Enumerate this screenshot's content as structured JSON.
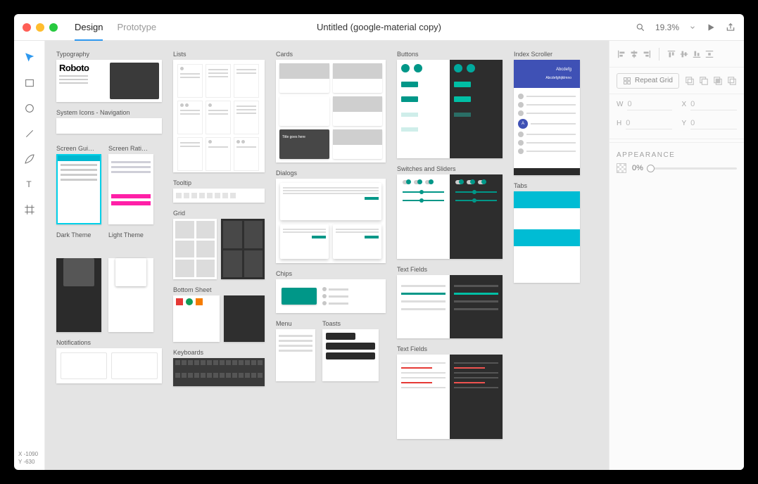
{
  "window": {
    "title": "Untitled (google-material copy)"
  },
  "tabs": {
    "design": "Design",
    "prototype": "Prototype"
  },
  "header": {
    "zoom": "19.3%",
    "icons": {
      "search": "search-icon",
      "chevron": "chevron-down-icon",
      "play": "play-icon",
      "share": "share-icon"
    }
  },
  "toolbar": {
    "items": [
      "select",
      "rectangle",
      "ellipse",
      "line",
      "pen",
      "text",
      "artboard"
    ]
  },
  "footer": {
    "x_label": "X",
    "x_value": "-1090",
    "y_label": "Y",
    "y_value": "-630"
  },
  "canvas": {
    "col1": {
      "typography": "Typography",
      "roboto": "Roboto",
      "iconsnav": "System Icons - Navigation",
      "screen_guide": "Screen Gui…",
      "screen_ratio": "Screen Rati…",
      "dark_theme": "Dark Theme",
      "light_theme": "Light Theme",
      "notifications": "Notifications"
    },
    "col2": {
      "lists": "Lists",
      "tooltip": "Tooltip",
      "grid": "Grid",
      "bottom_sheet": "Bottom Sheet",
      "keyboards": "Keyboards"
    },
    "col3": {
      "cards": "Cards",
      "card_title": "Title goes here",
      "dialogs": "Dialogs",
      "chips": "Chips",
      "menu": "Menu",
      "toasts": "Toasts"
    },
    "col4": {
      "buttons": "Buttons",
      "switches": "Switches and Sliders",
      "textfields": "Text Fields",
      "textfields2": "Text Fields"
    },
    "col5": {
      "index": "Index Scroller",
      "bubble1": "Abcdefg",
      "bubble2": "Abcdefghijklmno",
      "letter": "A",
      "tabs": "Tabs"
    }
  },
  "props": {
    "repeat": "Repeat Grid",
    "w_label": "W",
    "w_value": "0",
    "h_label": "H",
    "h_value": "0",
    "x_label": "X",
    "x_value": "0",
    "y_label": "Y",
    "y_value": "0",
    "appearance": "APPEARANCE",
    "opacity": "0%"
  }
}
